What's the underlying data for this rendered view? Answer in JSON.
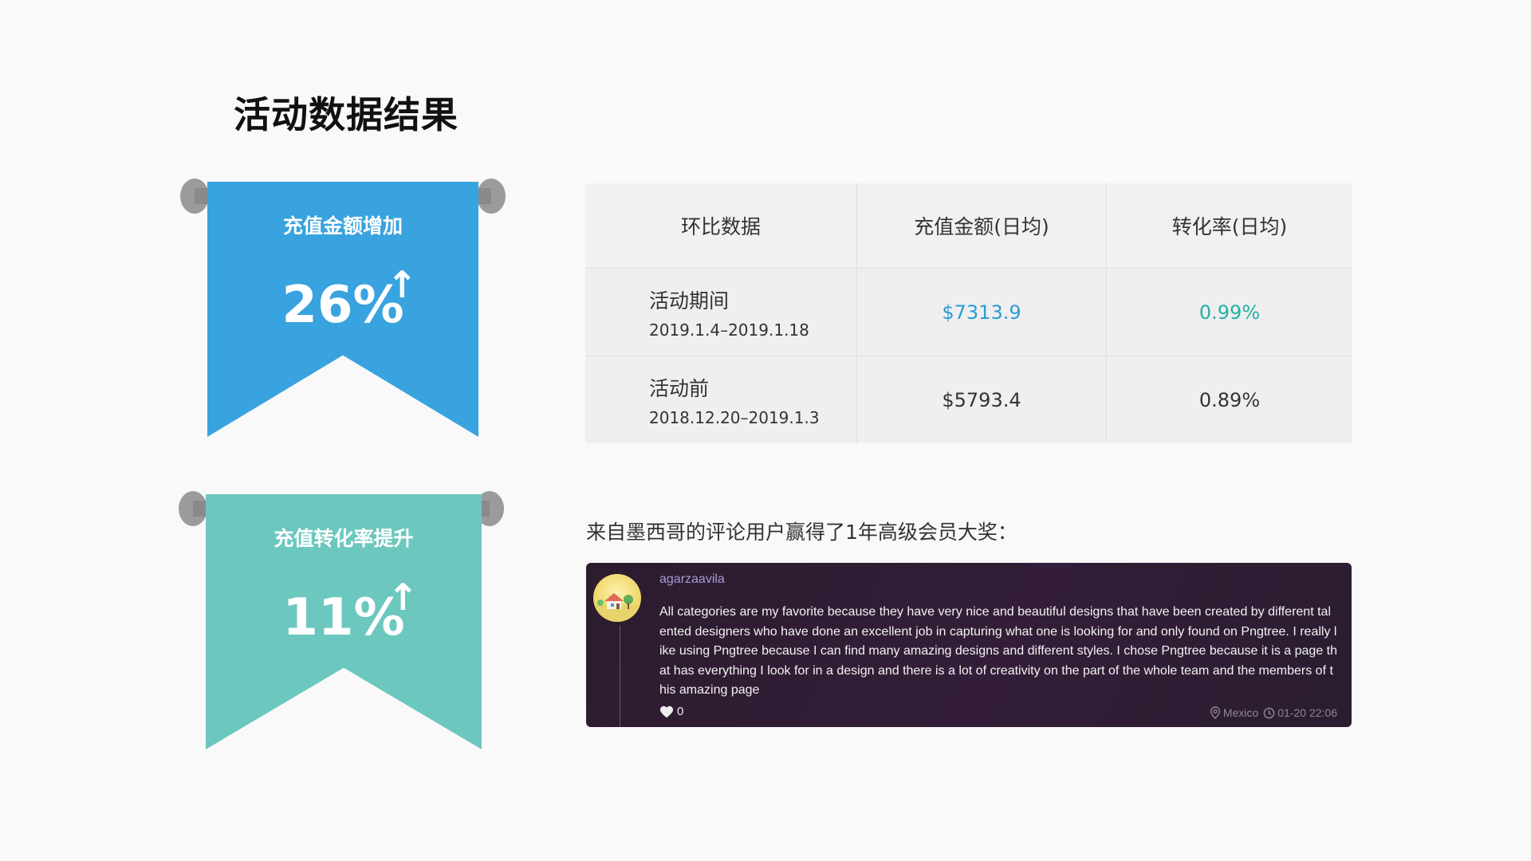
{
  "page": {
    "title": "活动数据结果"
  },
  "banners": [
    {
      "label": "充值金额增加",
      "value": "26%",
      "arrow": "↑",
      "color": "#38a3de"
    },
    {
      "label": "充值转化率提升",
      "value": "11%",
      "arrow": "↑",
      "color": "#6cc8bf"
    }
  ],
  "table": {
    "headers": [
      "环比数据",
      "充值金额(日均)",
      "转化率(日均)"
    ],
    "rows": [
      {
        "name": "活动期间",
        "dates": "2019.1.4–2019.1.18",
        "amount": "$7313.9",
        "rate": "0.99%"
      },
      {
        "name": "活动前",
        "dates": "2018.12.20–2019.1.3",
        "amount": "$5793.4",
        "rate": "0.89%"
      }
    ]
  },
  "caption": "来自墨西哥的评论用户赢得了1年高级会员大奖：",
  "comment": {
    "username": "agarzaavila",
    "text": "All categories are my favorite because they have very nice and beautiful designs that have been created by different talented designers who have done an excellent job in capturing what one is looking for and only found on Pngtree. I really like using Pngtree because I can find many amazing designs and different styles. I chose Pngtree because it is a page that has everything I look for in a design and there is a lot of creativity on the part of the whole team and the members of this amazing page",
    "likes": "0",
    "location": "Mexico",
    "time": "01-20 22:06"
  },
  "colors": {
    "blue": "#38a3de",
    "teal": "#6cc8bf",
    "amount_accent": "#2b9bd6",
    "rate_accent": "#20b2a7"
  },
  "icons": [
    "up-arrow-icon",
    "heart-icon",
    "location-pin-icon",
    "clock-icon"
  ]
}
